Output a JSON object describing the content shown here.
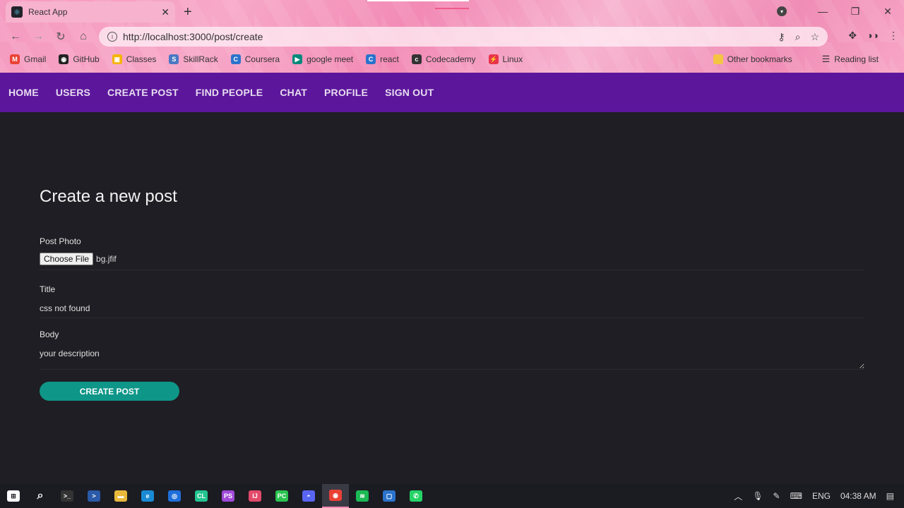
{
  "browser": {
    "tab_title": "React App",
    "url": "http://localhost:3000/post/create",
    "bookmarks": [
      {
        "label": "Gmail",
        "icon": "gmail-icon",
        "color": "#ea4335",
        "glyph": "M"
      },
      {
        "label": "GitHub",
        "icon": "github-icon",
        "color": "#222222",
        "glyph": "◉"
      },
      {
        "label": "Classes",
        "icon": "classroom-icon",
        "color": "#f4b400",
        "glyph": "▣"
      },
      {
        "label": "SkillRack",
        "icon": "skillrack-icon",
        "color": "#4a78c2",
        "glyph": "S"
      },
      {
        "label": "Coursera",
        "icon": "coursera-icon",
        "color": "#2a73cc",
        "glyph": "C"
      },
      {
        "label": "google meet",
        "icon": "meet-icon",
        "color": "#00897b",
        "glyph": "▶"
      },
      {
        "label": "react",
        "icon": "react-bm-icon",
        "color": "#2a73cc",
        "glyph": "C"
      },
      {
        "label": "Codecademy",
        "icon": "codecademy-icon",
        "color": "#333333",
        "glyph": "c"
      },
      {
        "label": "Linux",
        "icon": "linux-icon",
        "color": "#e8344a",
        "glyph": "⚡"
      }
    ],
    "other_bookmarks": "Other bookmarks",
    "reading_list": "Reading list"
  },
  "nav": {
    "items": [
      "HOME",
      "USERS",
      "CREATE POST",
      "FIND PEOPLE",
      "CHAT",
      "PROFILE",
      "SIGN OUT"
    ]
  },
  "form": {
    "heading": "Create a new post",
    "photo_label": "Post Photo",
    "file_button": "Choose File",
    "file_name": "bg.jfif",
    "title_label": "Title",
    "title_value": "css not found",
    "body_label": "Body",
    "body_value": "your description",
    "submit_label": "CREATE POST"
  },
  "taskbar": {
    "language": "ENG",
    "time": "04:38 AM",
    "apps": [
      {
        "name": "start-icon",
        "color": "#ffffff",
        "glyph": "⊞"
      },
      {
        "name": "search-icon",
        "color": "#1b1b22",
        "glyph": "⌕"
      },
      {
        "name": "terminal-icon",
        "color": "#333333",
        "glyph": ">_"
      },
      {
        "name": "powershell-icon",
        "color": "#2a5aa8",
        "glyph": ">"
      },
      {
        "name": "file-explorer-icon",
        "color": "#e8b83a",
        "glyph": "▬"
      },
      {
        "name": "edge-icon",
        "color": "#1a8ad4",
        "glyph": "e"
      },
      {
        "name": "app-icon",
        "color": "#1e6fd9",
        "glyph": "◎"
      },
      {
        "name": "clion-icon",
        "color": "#22c48f",
        "glyph": "CL"
      },
      {
        "name": "phpstorm-icon",
        "color": "#a04ad8",
        "glyph": "PS"
      },
      {
        "name": "intellij-icon",
        "color": "#e24a6a",
        "glyph": "IJ"
      },
      {
        "name": "pycharm-icon",
        "color": "#2ac44f",
        "glyph": "PC"
      },
      {
        "name": "discord-icon",
        "color": "#5865f2",
        "glyph": "◓"
      },
      {
        "name": "chrome-icon",
        "color": "#e94235",
        "glyph": "◉"
      },
      {
        "name": "spotify-icon",
        "color": "#1db954",
        "glyph": "≋"
      },
      {
        "name": "camera-icon",
        "color": "#2a73cc",
        "glyph": "▢"
      },
      {
        "name": "whatsapp-icon",
        "color": "#25d366",
        "glyph": "✆"
      }
    ]
  }
}
